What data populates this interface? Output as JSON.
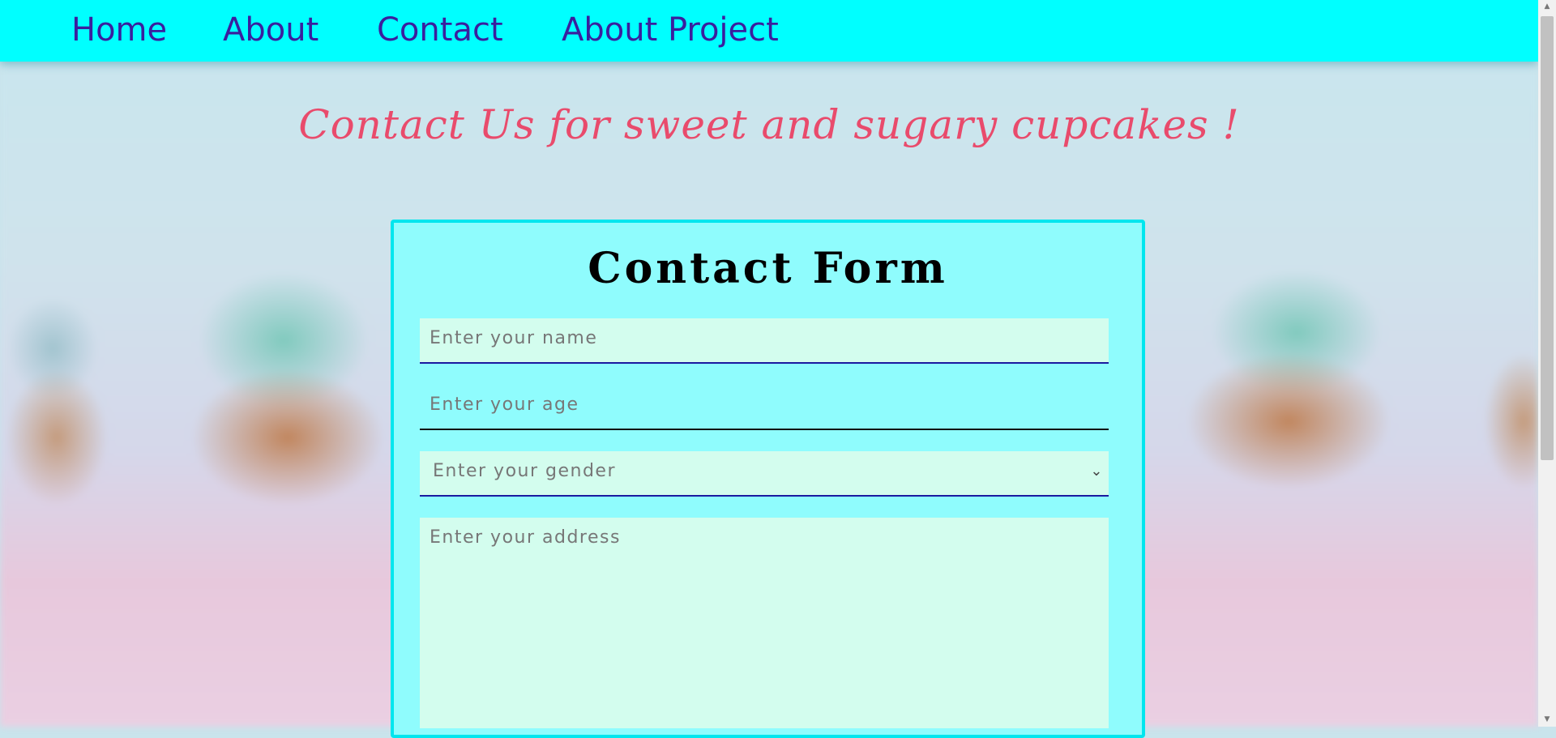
{
  "nav": {
    "items": [
      {
        "label": "Home"
      },
      {
        "label": "About"
      },
      {
        "label": "Contact"
      },
      {
        "label": "About Project"
      }
    ]
  },
  "headline": "Contact Us for sweet and sugary cupcakes !",
  "form": {
    "title": "Contact Form",
    "name_placeholder": "Enter your name",
    "age_placeholder": "Enter your age",
    "gender_placeholder": "Enter your gender",
    "address_placeholder": "Enter your address"
  },
  "colors": {
    "navbar": "#00ffff",
    "nav_text": "#3a1f9e",
    "headline": "#e94b6c",
    "form_bg": "#8ffcfd",
    "input_bg": "#d3fdee"
  }
}
